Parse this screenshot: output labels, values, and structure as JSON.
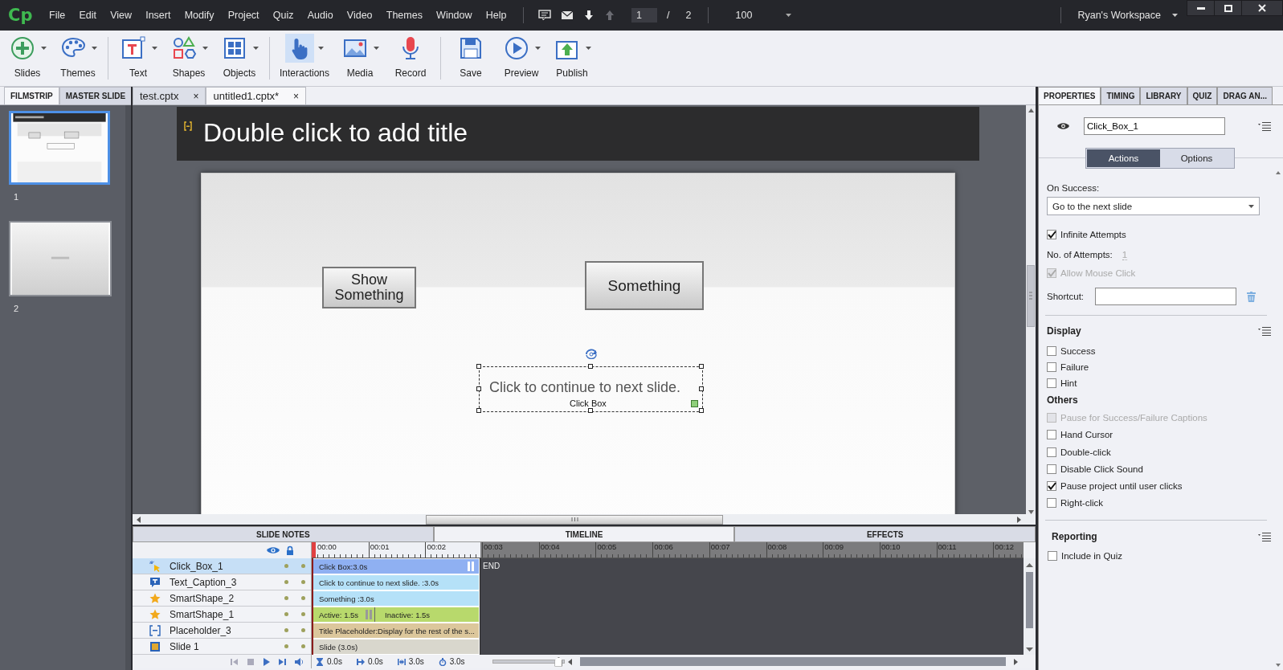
{
  "menubar": {
    "logo": "Cp",
    "menus": [
      "File",
      "Edit",
      "View",
      "Insert",
      "Modify",
      "Project",
      "Quiz",
      "Audio",
      "Video",
      "Themes",
      "Window",
      "Help"
    ],
    "page_current": "1",
    "page_separator": "/",
    "page_total": "2",
    "zoom": "100",
    "workspace": "Ryan's Workspace"
  },
  "toolbar": {
    "groups": [
      {
        "items": [
          {
            "label": "Slides",
            "dropdown": true,
            "selected": false
          },
          {
            "label": "Themes",
            "dropdown": true,
            "selected": false
          }
        ]
      },
      {
        "items": [
          {
            "label": "Text",
            "dropdown": true,
            "selected": false
          },
          {
            "label": "Shapes",
            "dropdown": true,
            "selected": false
          },
          {
            "label": "Objects",
            "dropdown": true,
            "selected": false
          }
        ]
      },
      {
        "items": [
          {
            "label": "Interactions",
            "dropdown": true,
            "selected": true
          },
          {
            "label": "Media",
            "dropdown": true,
            "selected": false
          },
          {
            "label": "Record",
            "dropdown": false,
            "selected": false
          }
        ]
      },
      {
        "items": [
          {
            "label": "Save",
            "dropdown": false,
            "selected": false
          },
          {
            "label": "Preview",
            "dropdown": true,
            "selected": false
          },
          {
            "label": "Publish",
            "dropdown": true,
            "selected": false
          }
        ]
      }
    ]
  },
  "panel_tabs": [
    {
      "label": "FILMSTRIP",
      "selected": true
    },
    {
      "label": "MASTER SLIDE",
      "selected": false
    }
  ],
  "doc_tabs": [
    {
      "label": "test.cptx",
      "close": "×",
      "selected": false
    },
    {
      "label": "untitled1.cptx*",
      "close": "×",
      "selected": true
    }
  ],
  "filmstrip": {
    "slides": [
      {
        "number": "1",
        "selected": true
      },
      {
        "number": "2",
        "selected": false
      }
    ]
  },
  "slide": {
    "title": "Double click to add title",
    "buttons": [
      {
        "label": "Show Something"
      },
      {
        "label": "Something"
      }
    ],
    "click_box": {
      "caption": "Click to continue to next slide.",
      "label": "Click Box"
    }
  },
  "bottom_tabs": [
    {
      "label": "SLIDE NOTES",
      "selected": false
    },
    {
      "label": "TIMELINE",
      "selected": true
    },
    {
      "label": "EFFECTS",
      "selected": false
    }
  ],
  "timeline": {
    "ruler": [
      "00:00",
      "00:01",
      "00:02",
      "00:03",
      "00:04",
      "00:05",
      "00:06",
      "00:07",
      "00:08",
      "00:09",
      "00:10",
      "00:11",
      "00:12"
    ],
    "end_label": "END",
    "layers": [
      {
        "name": "Click_Box_1",
        "kind": "click_box",
        "bar": "Click Box:3.0s",
        "color": "#8fb0f2",
        "pause_marker": true,
        "selected": true
      },
      {
        "name": "Text_Caption_3",
        "kind": "caption",
        "bar": "Click to continue to next slide. :3.0s",
        "color": "#b5e1f8",
        "pause_marker": false,
        "selected": false
      },
      {
        "name": "SmartShape_2",
        "kind": "smart_shape",
        "bar": "Something :3.0s",
        "color": "#b5e1f8",
        "pause_marker": false,
        "selected": false
      },
      {
        "name": "SmartShape_1",
        "kind": "smart_shape",
        "bar": "Active: 1.5s",
        "bar_inactive": "Inactive: 1.5s",
        "color": "#b8d96c",
        "pause_marker": false,
        "selected": false
      },
      {
        "name": "Placeholder_3",
        "kind": "placeholder",
        "bar": "Title Placeholder:Display for the rest of the s...",
        "color": "#dcc79c",
        "pause_marker": false,
        "selected": false
      },
      {
        "name": "Slide 1",
        "kind": "slide",
        "bar": "Slide (3.0s)",
        "color": "#d9d7cd",
        "pause_marker": false,
        "selected": false
      }
    ],
    "readouts": [
      "0.0s",
      "0.0s",
      "3.0s",
      "3.0s"
    ],
    "zoom_slider": {
      "level": 0.92
    }
  },
  "properties": {
    "tabs": [
      {
        "label": "PROPERTIES",
        "selected": true
      },
      {
        "label": "TIMING",
        "selected": false
      },
      {
        "label": "LIBRARY",
        "selected": false
      },
      {
        "label": "QUIZ",
        "selected": false
      },
      {
        "label": "DRAG AN...",
        "selected": false
      }
    ],
    "name": "Click_Box_1",
    "subtabs": [
      {
        "label": "Actions",
        "selected": true
      },
      {
        "label": "Options",
        "selected": false
      }
    ],
    "on_success_label": "On Success:",
    "on_success": "Go to the next slide",
    "attempt_options": [
      {
        "label": "Infinite Attempts",
        "checked": true,
        "disabled": false
      }
    ],
    "attempts_label": "No. of Attempts:",
    "attempts": "1",
    "mouse_options": [
      {
        "label": "Allow Mouse Click",
        "checked": true,
        "disabled": true
      }
    ],
    "shortcut_label": "Shortcut:",
    "sections": [
      {
        "title": "Display",
        "menu": true,
        "divider_before": true,
        "options": [
          {
            "label": "Success",
            "checked": false,
            "disabled": false
          },
          {
            "label": "Failure",
            "checked": false,
            "disabled": false
          },
          {
            "label": "Hint",
            "checked": false,
            "disabled": false
          }
        ]
      },
      {
        "title": "Others",
        "menu": false,
        "divider_before": false,
        "options": [
          {
            "label": "Pause for Success/Failure Captions",
            "checked": false,
            "disabled": true
          },
          {
            "label": "Hand Cursor",
            "checked": false,
            "disabled": false
          },
          {
            "label": "Double-click",
            "checked": false,
            "disabled": false
          },
          {
            "label": "Disable Click Sound",
            "checked": false,
            "disabled": false
          },
          {
            "label": "Pause project until user clicks",
            "checked": true,
            "disabled": false
          },
          {
            "label": "Right-click",
            "checked": false,
            "disabled": false
          }
        ]
      },
      {
        "title": "Reporting",
        "menu": true,
        "divider_before": true,
        "options": [
          {
            "label": "Include in Quiz",
            "checked": false,
            "disabled": false
          }
        ]
      }
    ]
  }
}
